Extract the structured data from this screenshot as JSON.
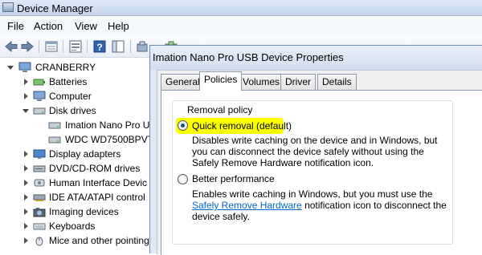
{
  "window": {
    "title": "Device Manager"
  },
  "menubar": [
    "File",
    "Action",
    "View",
    "Help"
  ],
  "toolbar": {
    "icons": [
      "back-arrow-icon",
      "forward-arrow-icon",
      "properties-sheet-icon",
      "show-hidden-icon",
      "help-icon",
      "console-tree-icon",
      "update-driver-icon",
      "scan-hardware-icon"
    ]
  },
  "tree": {
    "root": "CRANBERRY",
    "items": [
      {
        "label": "Batteries",
        "icon": "battery-icon",
        "state": "collapsed",
        "level": 1
      },
      {
        "label": "Computer",
        "icon": "computer-icon",
        "state": "collapsed",
        "level": 1
      },
      {
        "label": "Disk drives",
        "icon": "disk-drive-icon",
        "state": "expanded",
        "level": 1
      },
      {
        "label": "Imation Nano Pro U",
        "icon": "disk-drive-icon",
        "state": "leaf",
        "level": 2
      },
      {
        "label": "WDC WD7500BPVT-",
        "icon": "disk-drive-icon",
        "state": "leaf",
        "level": 2
      },
      {
        "label": "Display adapters",
        "icon": "display-adapter-icon",
        "state": "collapsed",
        "level": 1
      },
      {
        "label": "DVD/CD-ROM drives",
        "icon": "dvd-drive-icon",
        "state": "collapsed",
        "level": 1
      },
      {
        "label": "Human Interface Devic",
        "icon": "hid-icon",
        "state": "collapsed",
        "level": 1
      },
      {
        "label": "IDE ATA/ATAPI control",
        "icon": "ide-controller-icon",
        "state": "collapsed",
        "level": 1
      },
      {
        "label": "Imaging devices",
        "icon": "camera-icon",
        "state": "collapsed",
        "level": 1
      },
      {
        "label": "Keyboards",
        "icon": "keyboard-icon",
        "state": "collapsed",
        "level": 1
      },
      {
        "label": "Mice and other pointing",
        "icon": "mouse-icon",
        "state": "collapsed",
        "level": 1
      }
    ]
  },
  "dialog": {
    "title": "Imation Nano Pro USB Device Properties",
    "tabs": [
      {
        "label": "General",
        "active": false
      },
      {
        "label": "Policies",
        "active": true
      },
      {
        "label": "Volumes",
        "active": false
      },
      {
        "label": "Driver",
        "active": false
      },
      {
        "label": "Details",
        "active": false
      }
    ],
    "group_title": "Removal policy",
    "options": [
      {
        "label": "Quick removal (default)",
        "checked": true,
        "highlighted": true,
        "description": "Disables write caching on the device and in Windows, but you can disconnect the device safely without using the Safely Remove Hardware notification icon."
      },
      {
        "label": "Better performance",
        "checked": false,
        "highlighted": false,
        "description_before_link": "Enables write caching in Windows, but you must use the",
        "description_link": "Safely Remove Hardware",
        "description_after_link": "notification icon to disconnect the device safely."
      }
    ]
  },
  "colors": {
    "highlight": "#fcff00",
    "link": "#0066cc",
    "dialog_frame": "#dfe8f3"
  }
}
